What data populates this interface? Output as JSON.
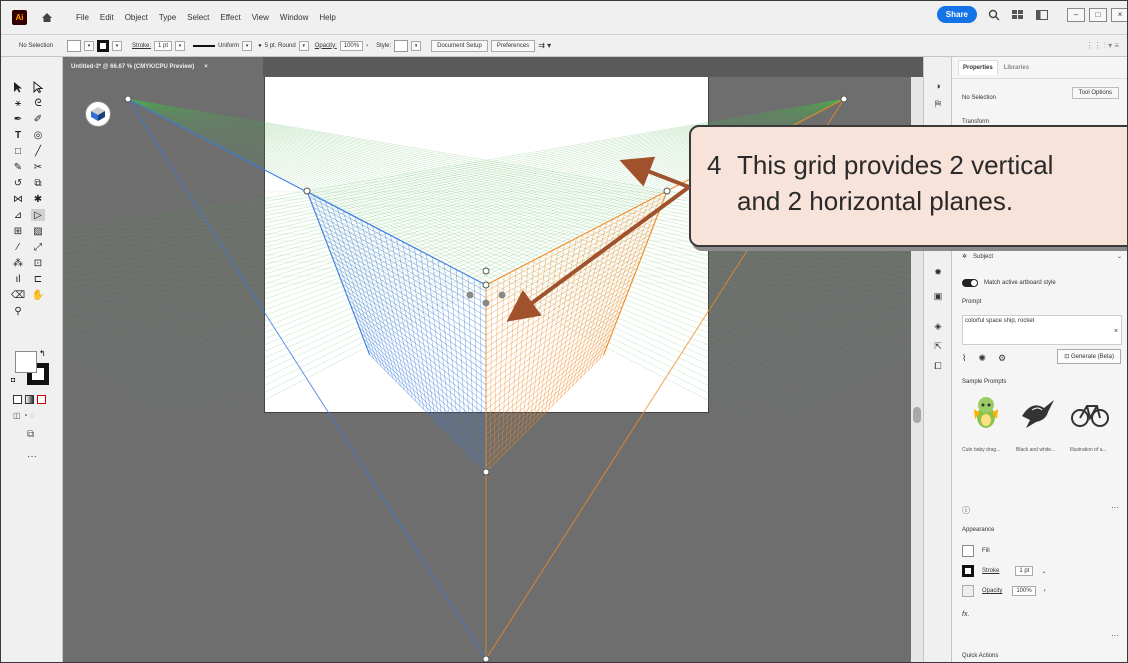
{
  "menubar": {
    "logo": "Ai",
    "menus": [
      "File",
      "Edit",
      "Object",
      "Type",
      "Select",
      "Effect",
      "View",
      "Window",
      "Help"
    ],
    "share_label": "Share"
  },
  "controlbar": {
    "selection": "No Selection",
    "stroke_label": "Stroke:",
    "stroke_value": "1 pt",
    "profile": "Uniform",
    "brush": "5 pt. Round",
    "opacity_label": "Opacity:",
    "opacity_value": "100%",
    "style_label": "Style:",
    "document_setup": "Document Setup",
    "preferences": "Preferences"
  },
  "document_tab": {
    "title": "Untitled-3* @ 66.67 % (CMYK/CPU Preview)",
    "close": "×"
  },
  "panel": {
    "tab_properties": "Properties",
    "tab_libraries": "Libraries",
    "no_selection": "No Selection",
    "tool_options": "Tool Options",
    "transform": "Transform",
    "subject": "Subject",
    "match_style": "Match active artboard style",
    "prompt_label": "Prompt",
    "prompt_value": "colorful space ship, rocket",
    "generate": "Generate (Beta)",
    "sample_prompts": "Sample Prompts",
    "samples": [
      "Cute baby drag...",
      "Black and white...",
      "Illustration of a..."
    ],
    "appearance": "Appearance",
    "fill": "Fill",
    "stroke": "Stroke",
    "stroke_value": "1 pt",
    "opacity": "Opacity",
    "opacity_value": "100%",
    "fx": "fx.",
    "quick_actions": "Quick Actions"
  },
  "callout": {
    "number": "4",
    "line1": "This grid provides 2 vertical",
    "line2": "and 2 horizontal planes.",
    "fill": "#f7e3da",
    "arrow_color": "#a0522d"
  },
  "colors": {
    "left_grid": "#3a7be0",
    "right_grid": "#f08a24",
    "horizon_grid": "#4caf50",
    "share": "#1473e6"
  }
}
